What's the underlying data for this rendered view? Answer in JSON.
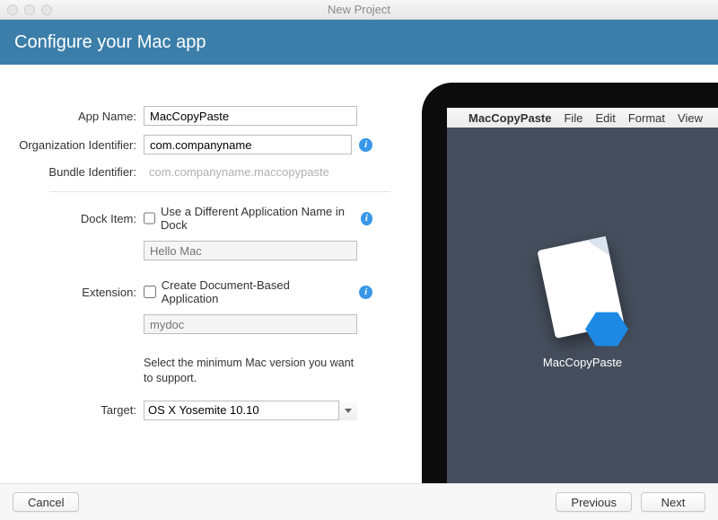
{
  "window": {
    "title": "New Project"
  },
  "banner": {
    "heading": "Configure your Mac app"
  },
  "form": {
    "appName": {
      "label": "App Name:",
      "value": "MacCopyPaste"
    },
    "orgId": {
      "label": "Organization Identifier:",
      "value": "com.companyname"
    },
    "bundleId": {
      "label": "Bundle Identifier:",
      "value": "com.companyname.maccopypaste"
    },
    "dockItem": {
      "label": "Dock Item:",
      "checkboxLabel": "Use a Different Application Name in Dock",
      "checked": false,
      "placeholder": "Hello Mac"
    },
    "extension": {
      "label": "Extension:",
      "checkboxLabel": "Create Document-Based Application",
      "checked": false,
      "placeholder": "mydoc"
    },
    "target": {
      "label": "Target:",
      "helper": "Select the minimum Mac version you want to support.",
      "selected": "OS X Yosemite 10.10"
    }
  },
  "preview": {
    "menubar": {
      "appName": "MacCopyPaste",
      "items": [
        "File",
        "Edit",
        "Format",
        "View"
      ]
    },
    "caption": "MacCopyPaste"
  },
  "footer": {
    "cancel": "Cancel",
    "previous": "Previous",
    "next": "Next"
  }
}
